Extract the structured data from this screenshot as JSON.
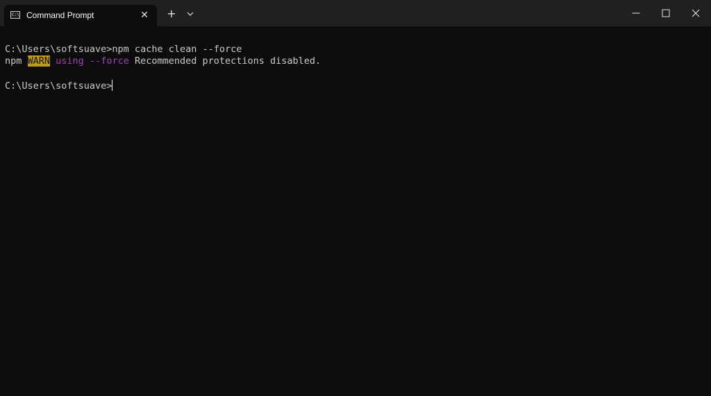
{
  "window": {
    "tab_title": "Command Prompt",
    "tab_icon": "cmd-icon",
    "tab_icon_text": "C:\\",
    "new_tab_symbol": "+",
    "close_tab_symbol": "✕",
    "icons": [
      "cmd-icon",
      "close-icon",
      "plus-icon",
      "chevron-down-icon",
      "minimize-icon",
      "maximize-icon",
      "close-window-icon"
    ]
  },
  "terminal": {
    "line1": "C:\\Users\\softsuave>npm cache clean --force",
    "line2": {
      "prefix": "npm ",
      "warn": "WARN",
      "space": " ",
      "using": "using --force",
      "rest": " Recommended protections disabled."
    },
    "prompt": "C:\\Users\\softsuave>"
  },
  "colors": {
    "background": "#0c0c0c",
    "titlebar": "#202020",
    "text": "#cccccc",
    "warn_bg": "#c19c00",
    "accent_purple": "#a043b8"
  }
}
